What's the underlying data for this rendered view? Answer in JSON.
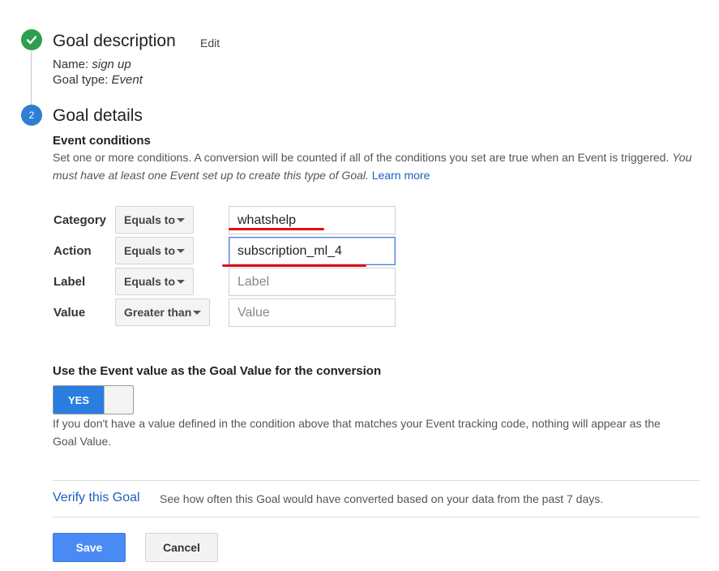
{
  "step1": {
    "title": "Goal description",
    "edit_label": "Edit",
    "name_label": "Name:",
    "name_value": "sign up",
    "type_label": "Goal type:",
    "type_value": "Event"
  },
  "step2": {
    "number": "2",
    "title": "Goal details"
  },
  "event_conditions": {
    "heading": "Event conditions",
    "description": "Set one or more conditions. A conversion will be counted if all of the conditions you set are true when an Event is triggered.",
    "description_italic": "You must have at least one Event set up to create this type of Goal.",
    "learn_more": "Learn more",
    "rows": [
      {
        "label": "Category",
        "operator": "Equals to",
        "value": "whatshelp",
        "placeholder": ""
      },
      {
        "label": "Action",
        "operator": "Equals to",
        "value": "subscription_ml_4",
        "placeholder": ""
      },
      {
        "label": "Label",
        "operator": "Equals to",
        "value": "",
        "placeholder": "Label"
      },
      {
        "label": "Value",
        "operator": "Greater than",
        "value": "",
        "placeholder": "Value"
      }
    ]
  },
  "goal_value": {
    "heading": "Use the Event value as the Goal Value for the conversion",
    "toggle_label": "YES",
    "toggle_state": "on",
    "help": "If you don't have a value defined in the condition above that matches your Event tracking code, nothing will appear as the Goal Value."
  },
  "verify": {
    "link": "Verify this Goal",
    "description": "See how often this Goal would have converted based on your data from the past 7 days."
  },
  "buttons": {
    "save": "Save",
    "cancel": "Cancel"
  },
  "colors": {
    "accent": "#4a8af4",
    "step_done": "#2e9e4e",
    "step_active": "#2c7fd1",
    "annotation": "#e01010"
  }
}
